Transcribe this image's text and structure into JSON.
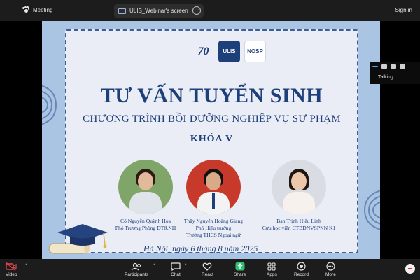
{
  "topbar": {
    "meeting_label": "Meeting",
    "screen_tab_label": "ULIS_Webinar's screen",
    "signin_label": "Sign in"
  },
  "mini_panel": {
    "talking_label": "Talking:"
  },
  "slide": {
    "logos": [
      "70",
      "ULIS",
      "NOSP"
    ],
    "title": "TƯ VẤN TUYỂN SINH",
    "subtitle": "CHƯƠNG TRÌNH BỒI DƯỠNG NGHIỆP VỤ SƯ PHẠM",
    "course": "KHÓA  V",
    "speakers": [
      {
        "line1": "Cô Nguyễn Quỳnh Hoa",
        "line2": "Phó Trưởng Phòng ĐT&NH",
        "line3": ""
      },
      {
        "line1": "Thầy Nguyễn Hoàng Giang",
        "line2": "Phó Hiệu trưởng",
        "line3": "Trường THCS Ngoại ngữ"
      },
      {
        "line1": "Bạn Trịnh Hiểu Linh",
        "line2": "Cựu học viên CTBDNVSPNN K1",
        "line3": ""
      }
    ],
    "date": "Hà Nội, ngày 6 tháng 8 năm 2025"
  },
  "toolbar": {
    "items": [
      "Video",
      "Participants",
      "Chat",
      "React",
      "Share",
      "Apps",
      "Record",
      "More"
    ]
  },
  "colors": {
    "slide_bg": "#aac4e3",
    "navy": "#1d3f7a",
    "share_green": "#2fbf71",
    "video_off_red": "#e0484d"
  }
}
